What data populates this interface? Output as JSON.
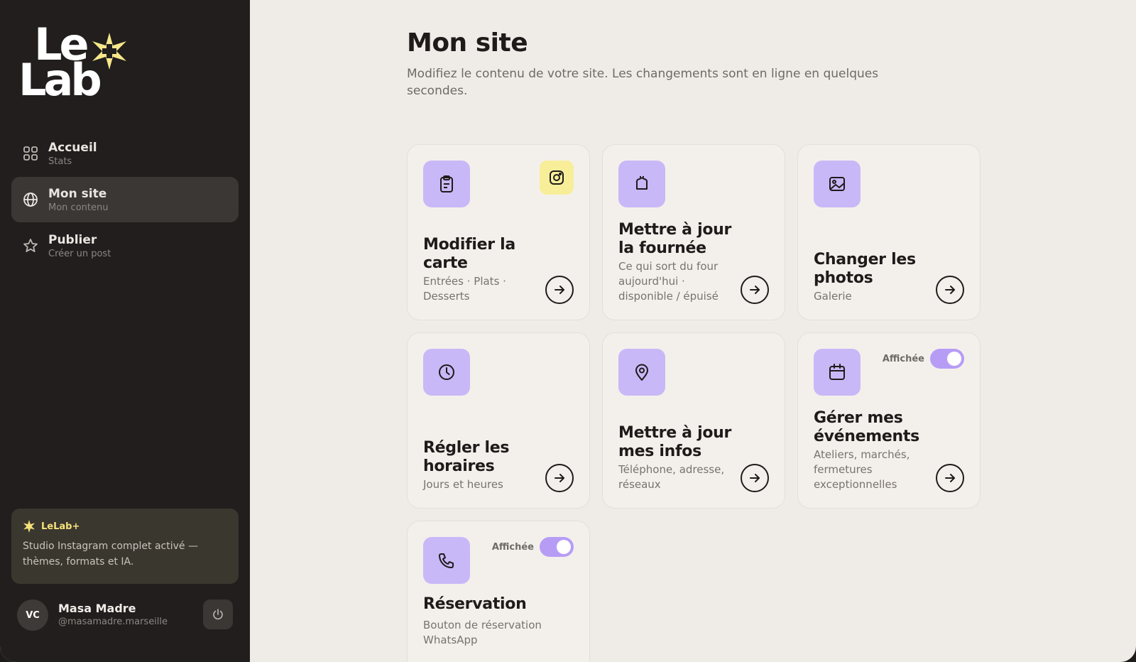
{
  "brand": {
    "line1": "Le",
    "line2": "Lab"
  },
  "nav": [
    {
      "label": "Accueil",
      "sub": "Stats",
      "icon": "grid-icon"
    },
    {
      "label": "Mon site",
      "sub": "Mon contenu",
      "icon": "globe-icon",
      "active": true
    },
    {
      "label": "Publier",
      "sub": "Créer un post",
      "icon": "star-icon"
    }
  ],
  "promo": {
    "title": "LeLab+",
    "text": "Studio Instagram complet activé — thèmes, formats et IA."
  },
  "user": {
    "initials": "VC",
    "name": "Masa Madre",
    "handle": "@masamadre.marseille"
  },
  "page": {
    "title": "Mon site",
    "subtitle": "Modifiez le contenu de votre site. Les changements sont en ligne en quelques secondes."
  },
  "cards": [
    {
      "title": "Modifier la carte",
      "desc": "Entrées · Plats · Desserts",
      "icon": "clipboard-icon",
      "badge": "instagram-icon"
    },
    {
      "title": "Mettre à jour la fournée",
      "desc": "Ce qui sort du four aujourd'hui · disponible / épuisé",
      "icon": "bread-icon"
    },
    {
      "title": "Changer les photos",
      "desc": "Galerie",
      "icon": "image-icon"
    },
    {
      "title": "Régler les horaires",
      "desc": "Jours et heures",
      "icon": "clock-icon"
    },
    {
      "title": "Mettre à jour mes infos",
      "desc": "Téléphone, adresse, réseaux",
      "icon": "map-pin-icon"
    },
    {
      "title": "Gérer mes événements",
      "desc": "Ateliers, marchés, fermetures exceptionnelles",
      "icon": "calendar-icon",
      "toggle": "Affichée"
    },
    {
      "title": "Réservation",
      "desc": "Bouton de réservation WhatsApp",
      "icon": "phone-icon",
      "toggle": "Affichée"
    }
  ],
  "colors": {
    "sidebar": "#211e1d",
    "accent_purple": "#c9b8f7",
    "accent_yellow": "#f8ee9a",
    "background": "#efece8"
  }
}
